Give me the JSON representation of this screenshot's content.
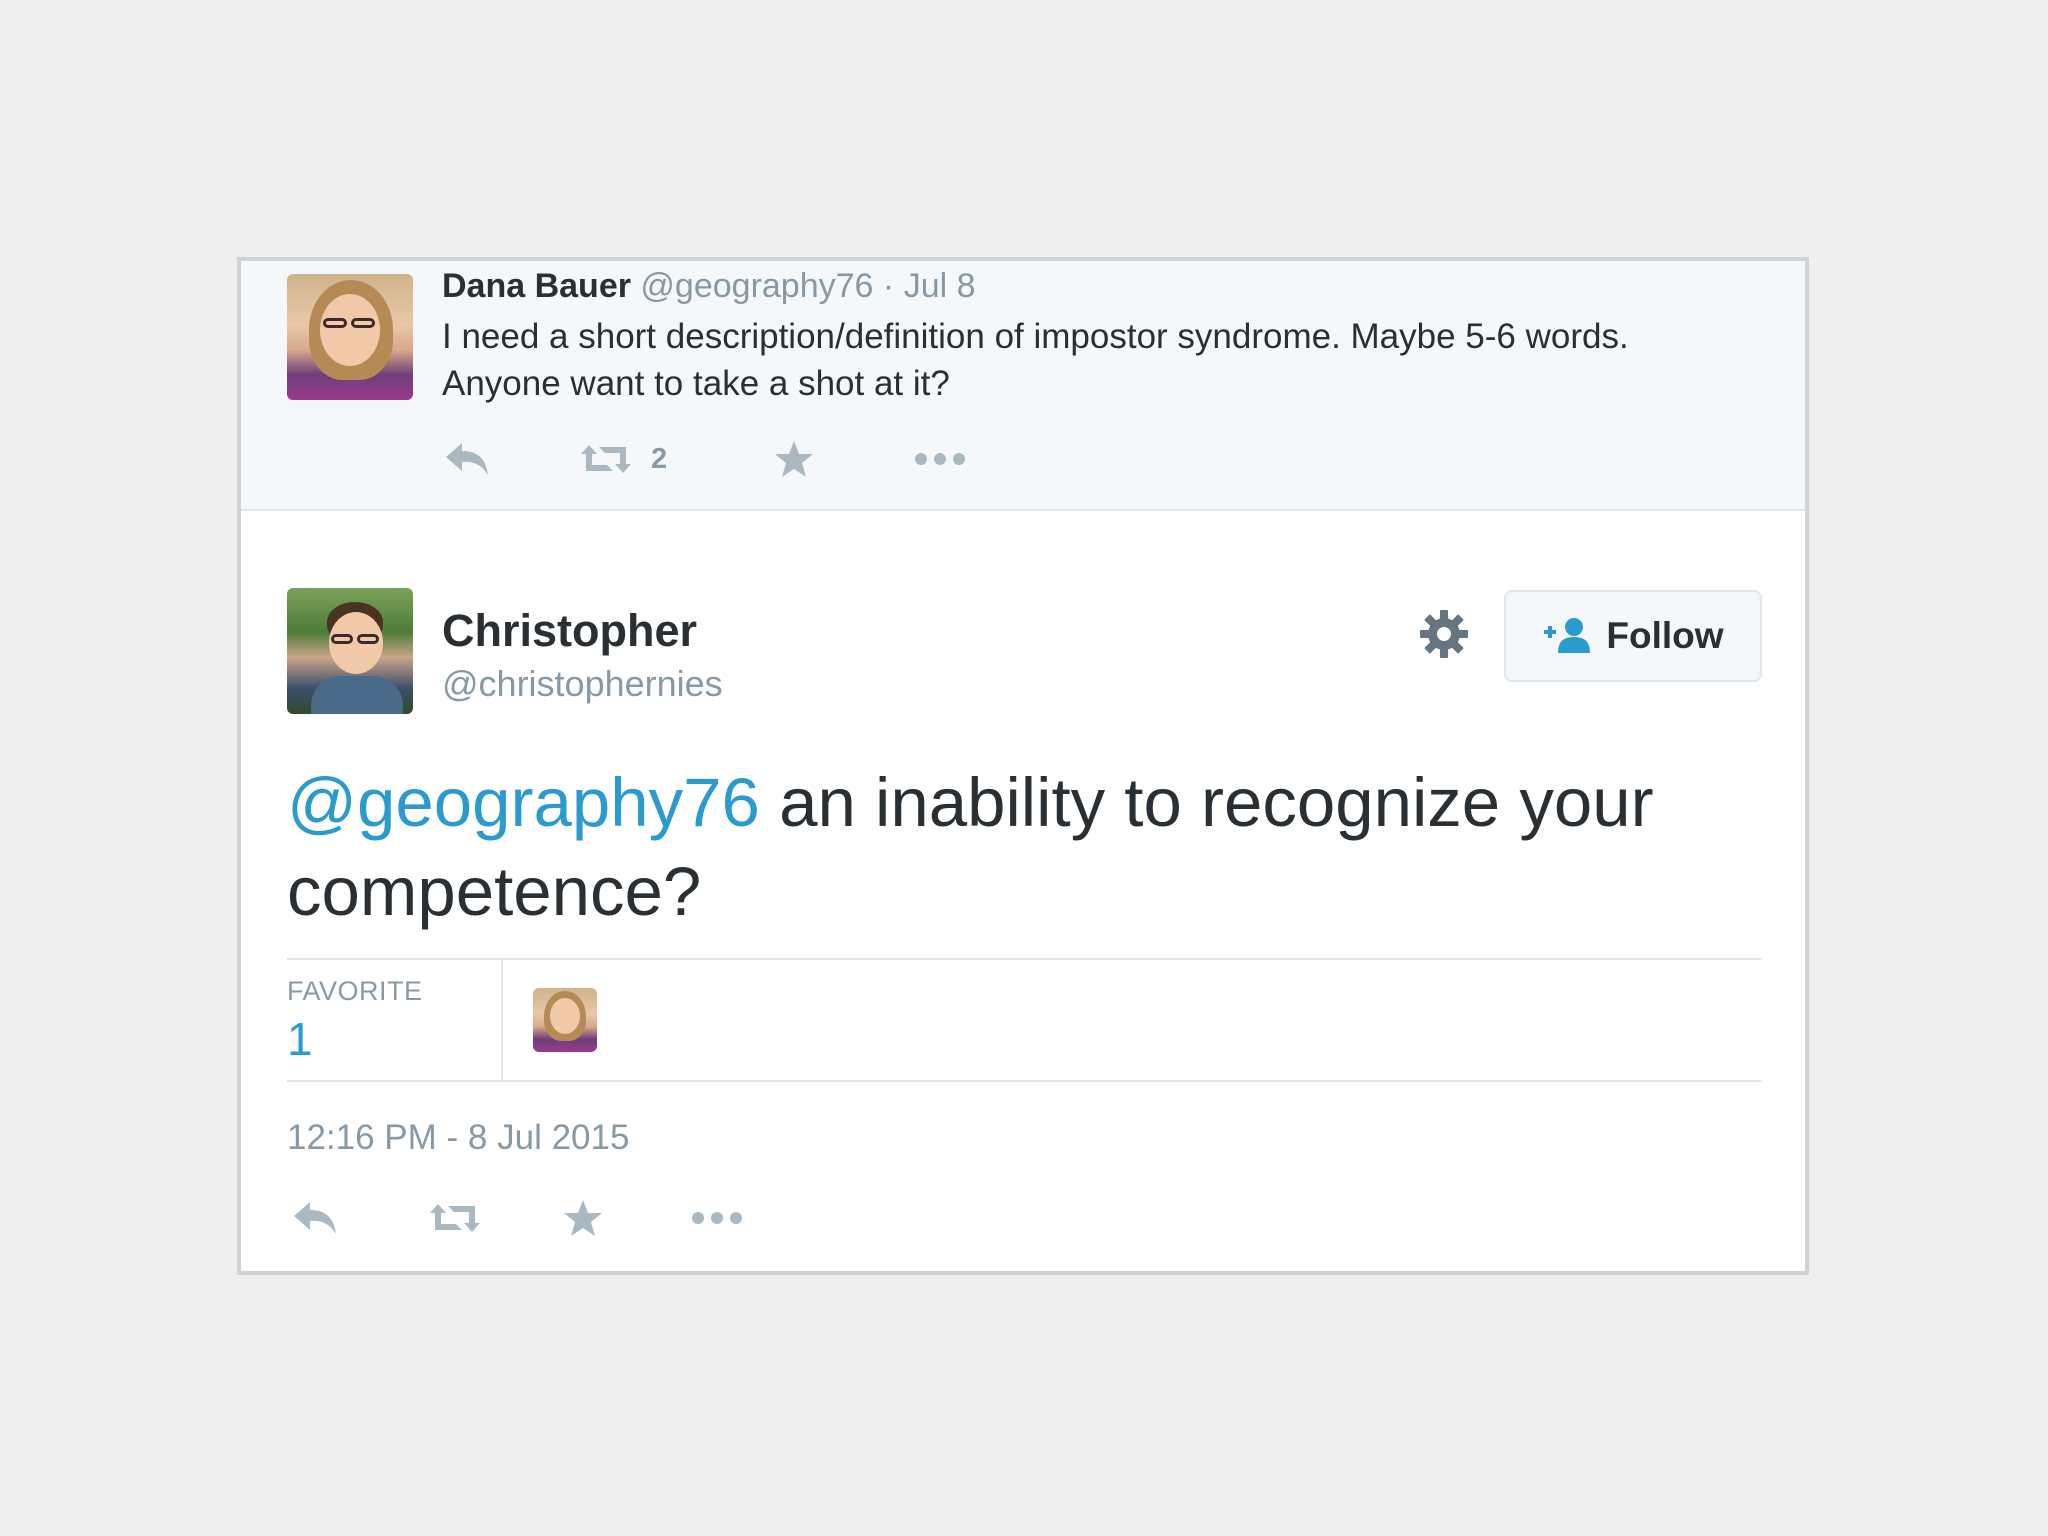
{
  "reply_tweet": {
    "name": "Dana Bauer",
    "handle": "@geography76",
    "separator": "·",
    "date": "Jul 8",
    "text": "I need a short description/definition of impostor syndrome. Maybe 5-6 words. Anyone want to take a shot at it?",
    "retweet_count": "2",
    "icons": [
      "reply-icon",
      "retweet-icon",
      "favorite-icon",
      "more-icon"
    ]
  },
  "main_tweet": {
    "name": "Christopher",
    "handle": "@christophernies",
    "follow_label": "Follow",
    "mention": "@geography76",
    "text": " an inability to recognize your competence?",
    "stats": {
      "label": "FAVORITE",
      "value": "1"
    },
    "timestamp": "12:16 PM - 8 Jul 2015",
    "icons": [
      "reply-icon",
      "retweet-icon",
      "favorite-icon",
      "more-icon",
      "gear-icon",
      "follow-person-icon"
    ]
  },
  "colors": {
    "accent": "#2b9bcf",
    "text": "#292f33",
    "muted": "#8899a6",
    "icon": "#aab8c2",
    "reply_bg": "#f5f8fa",
    "page_bg": "#efeff0"
  }
}
